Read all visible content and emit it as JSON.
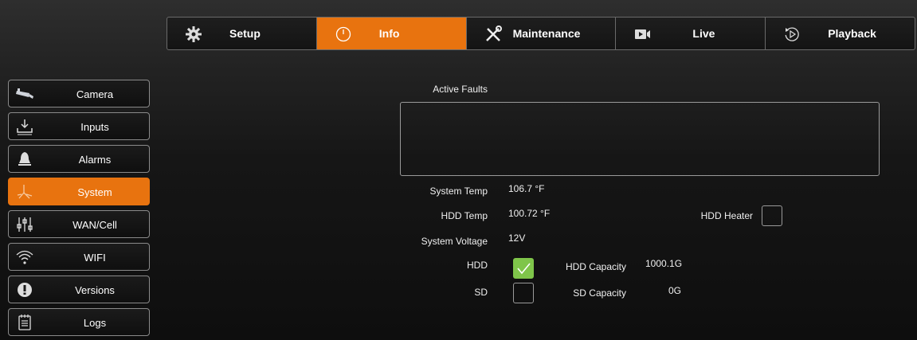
{
  "topnav": {
    "tabs": [
      {
        "label": "Setup",
        "icon": "gear-icon"
      },
      {
        "label": "Info",
        "icon": "clock-icon",
        "active": true
      },
      {
        "label": "Maintenance",
        "icon": "tools-icon"
      },
      {
        "label": "Live",
        "icon": "video-camera-icon"
      },
      {
        "label": "Playback",
        "icon": "replay-icon"
      }
    ]
  },
  "sidebar": {
    "items": [
      {
        "label": "Camera",
        "icon": "cctv-camera-icon"
      },
      {
        "label": "Inputs",
        "icon": "inputs-icon"
      },
      {
        "label": "Alarms",
        "icon": "bell-icon"
      },
      {
        "label": "System",
        "icon": "system-icon",
        "active": true
      },
      {
        "label": "WAN/Cell",
        "icon": "sliders-icon"
      },
      {
        "label": "WIFI",
        "icon": "wifi-icon"
      },
      {
        "label": "Versions",
        "icon": "info-icon"
      },
      {
        "label": "Logs",
        "icon": "log-icon"
      }
    ]
  },
  "info": {
    "active_faults_label": "Active Faults",
    "system_temp_label": "System Temp",
    "system_temp_value": "106.7 °F",
    "hdd_temp_label": "HDD Temp",
    "hdd_temp_value": "100.72 °F",
    "hdd_heater_label": "HDD Heater",
    "hdd_heater_checked": false,
    "system_voltage_label": "System Voltage",
    "system_voltage_value": "12V",
    "hdd_label": "HDD",
    "hdd_checked": true,
    "hdd_capacity_label": "HDD Capacity",
    "hdd_capacity_value": "1000.1G",
    "sd_label": "SD",
    "sd_checked": false,
    "sd_capacity_label": "SD Capacity",
    "sd_capacity_value": "0G"
  },
  "colors": {
    "accent": "#e8730f",
    "check_green": "#7fc54a",
    "border": "#9a9a9a"
  }
}
